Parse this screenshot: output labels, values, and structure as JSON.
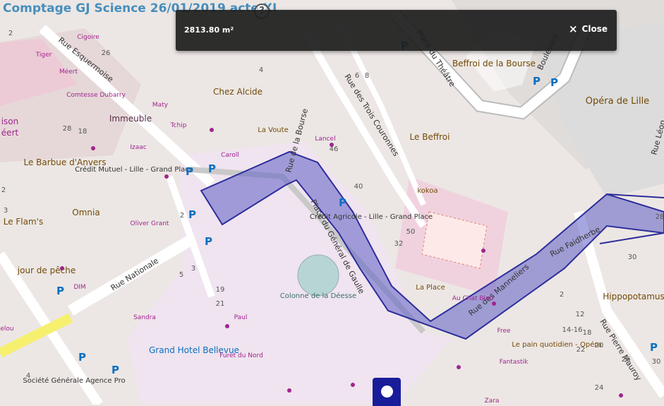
{
  "app": {
    "title": "Comptage GJ Science 26/01/2019 acte XI"
  },
  "help_icon": "?",
  "measure_popup": {
    "value": "2813.80 m²",
    "close_label": "Close",
    "close_icon": "×"
  },
  "colors": {
    "polygon_fill": "#5f5fc4",
    "polygon_stroke": "#2d2d9c",
    "plaza": "#efe4ef",
    "road": "#ffffff",
    "poi_magenta": "#a0258f",
    "poi_brown": "#734a08",
    "poi_blue": "#0a6fc0",
    "marker": "#1a1d99"
  },
  "map_labels": {
    "streets": [
      "Rue Esquermoise",
      "Rue Nationale",
      "Place du Général de Gaulle",
      "Rue de la Bourse",
      "Rue des Trois Couronnes",
      "Rue des Manneliers",
      "Rue Faidherbe",
      "Rue Pierre Mauroy",
      "Place du Théâtre",
      "Boulevard",
      "Rue Léon"
    ],
    "places": [
      "Cigoire",
      "Tiger",
      "Méert",
      "Comtesse Dubarry",
      "Maty",
      "Immeuble",
      "Tchip",
      "Chez Alcide",
      "La Voute",
      "Lancel",
      "Caroll",
      "Izaac",
      "Le Barbue d'Anvers",
      "Crédit Mutuel - Lille - Grand Place",
      "Omnia",
      "Le Flam's",
      "Oliver Grant",
      "jour de pêche",
      "DIM",
      "Crédit Agricole - Lille - Grand Place",
      "kokoa",
      "Le Beffroi",
      "Beffroi de la Bourse",
      "Opéra de Lille",
      "Colonne de la Déesse",
      "Sandra",
      "Paul",
      "Grand Hotel Bellevue",
      "Furet du Nord",
      "Société Générale Agence Pro",
      "La Place",
      "Au Chat Bleu",
      "Free",
      "Le pain quotidien - Opéra",
      "Fantastik",
      "Zara",
      "Hippopotamus",
      "ison",
      "éert",
      "elou"
    ],
    "house_numbers": [
      "26",
      "28",
      "18",
      "8",
      "6",
      "4",
      "2",
      "2",
      "5",
      "3",
      "21",
      "19",
      "40",
      "46",
      "50",
      "32",
      "30",
      "2",
      "12",
      "14-16",
      "18",
      "20",
      "22",
      "24",
      "26",
      "28",
      "30",
      "4",
      "2",
      "3"
    ]
  }
}
